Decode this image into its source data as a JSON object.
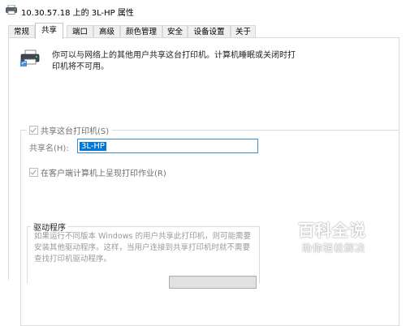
{
  "window": {
    "title": "10.30.57.18 上的 3L-HP 属性",
    "icon": "printer-icon"
  },
  "tabs": [
    {
      "label": "常规",
      "active": false
    },
    {
      "label": "共享",
      "active": true
    },
    {
      "label": "端口",
      "active": false
    },
    {
      "label": "高级",
      "active": false
    },
    {
      "label": "颜色管理",
      "active": false
    },
    {
      "label": "安全",
      "active": false
    },
    {
      "label": "设备设置",
      "active": false
    },
    {
      "label": "关于",
      "active": false
    }
  ],
  "sharing": {
    "description": "你可以与网络上的其他用户共享这台打印机。计算机睡眠或关闭时打印机将不可用。",
    "share_checkbox_label": "共享这台打印机(S)",
    "share_checked": true,
    "share_name_label": "共享名(H):",
    "share_name_value": "3L-HP",
    "render_jobs_label": "在客户端计算机上呈现打印作业(R)",
    "render_jobs_checked": true
  },
  "drivers": {
    "title": "驱动程序",
    "text": "如果运行不同版本 Windows 的用户共享此打印机，则可能需要安装其他驱动程序。这样，当用户连接到共享打印机时就不需要查找打印机驱动程序。"
  },
  "watermark": {
    "title": "百科全说",
    "subtitle": "助你轻松解决"
  },
  "colors": {
    "selection": "#0078d7",
    "input_border": "#3c8ad8",
    "disabled_text": "#6e6e6e"
  }
}
